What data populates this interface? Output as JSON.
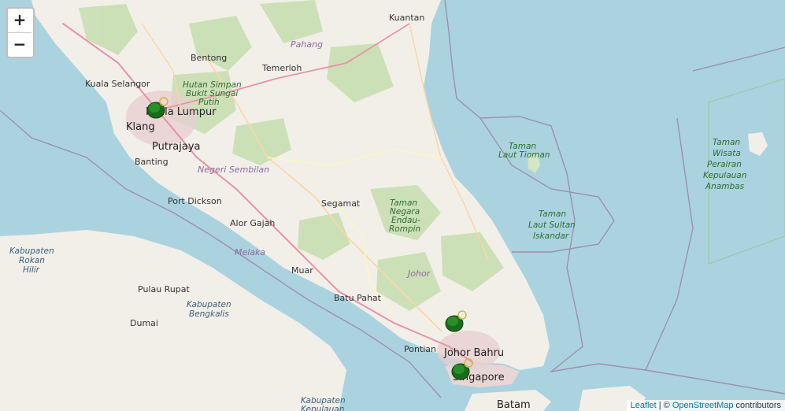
{
  "zoom": {
    "in_label": "+",
    "out_label": "−"
  },
  "attribution": {
    "leaflet": "Leaflet",
    "separator": " | © ",
    "osm": "OpenStreetMap",
    "suffix": " contributors"
  },
  "labels": {
    "kuantan": "Kuantan",
    "pahang": "Pahang",
    "bentong": "Bentong",
    "temerloh": "Temerloh",
    "kuala_selangor": "Kuala Selangor",
    "hulu_1": "Hutan Simpan",
    "hulu_2": "Bukit Sungai",
    "hulu_3": "Putih",
    "kuala_lumpur": "Kuala Lumpur",
    "klang": "Klang",
    "putrajaya": "Putrajaya",
    "banting": "Banting",
    "negeri_sembilan": "Negeri Sembilan",
    "port_dickson": "Port Dickson",
    "alor_gajah": "Alor Gajah",
    "melaka": "Melaka",
    "segamat": "Segamat",
    "endau_1": "Taman",
    "endau_2": "Negara",
    "endau_3": "Endau-",
    "endau_4": "Rompin",
    "muar": "Muar",
    "batu_pahat": "Batu Pahat",
    "johor": "Johor",
    "pontian": "Pontian",
    "johor_bahru": "Johor Bahru",
    "singapore": "Singapore",
    "batam": "Batam",
    "tioman_1": "Taman",
    "tioman_2": "Laut Tioman",
    "iskandar_1": "Taman",
    "iskandar_2": "Laut Sultan",
    "iskandar_3": "Iskandar",
    "anambas_1": "Taman",
    "anambas_2": "Wisata",
    "anambas_3": "Perairan",
    "anambas_4": "Kepulauan",
    "anambas_5": "Anambas",
    "rokan_1": "Kabupaten",
    "rokan_2": "Rokan",
    "rokan_3": "Hilir",
    "pulau_rupat": "Pulau Rupat",
    "bengkalis_1": "Kabupaten",
    "bengkalis_2": "Bengkalis",
    "dumai": "Dumai",
    "kepulauan_1": "Kabupaten",
    "kepulauan_2": "Kepulauan"
  }
}
